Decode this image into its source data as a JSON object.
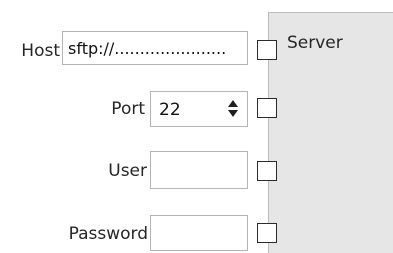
{
  "form": {
    "host": {
      "label": "Host",
      "value": "sftp://......................"
    },
    "port": {
      "label": "Port",
      "value": "22"
    },
    "user": {
      "label": "User",
      "value": ""
    },
    "password": {
      "label": "Password",
      "value": ""
    }
  },
  "server_panel": {
    "label": "Server"
  },
  "icons": {
    "port_spinner": "up-down-arrows-icon"
  }
}
